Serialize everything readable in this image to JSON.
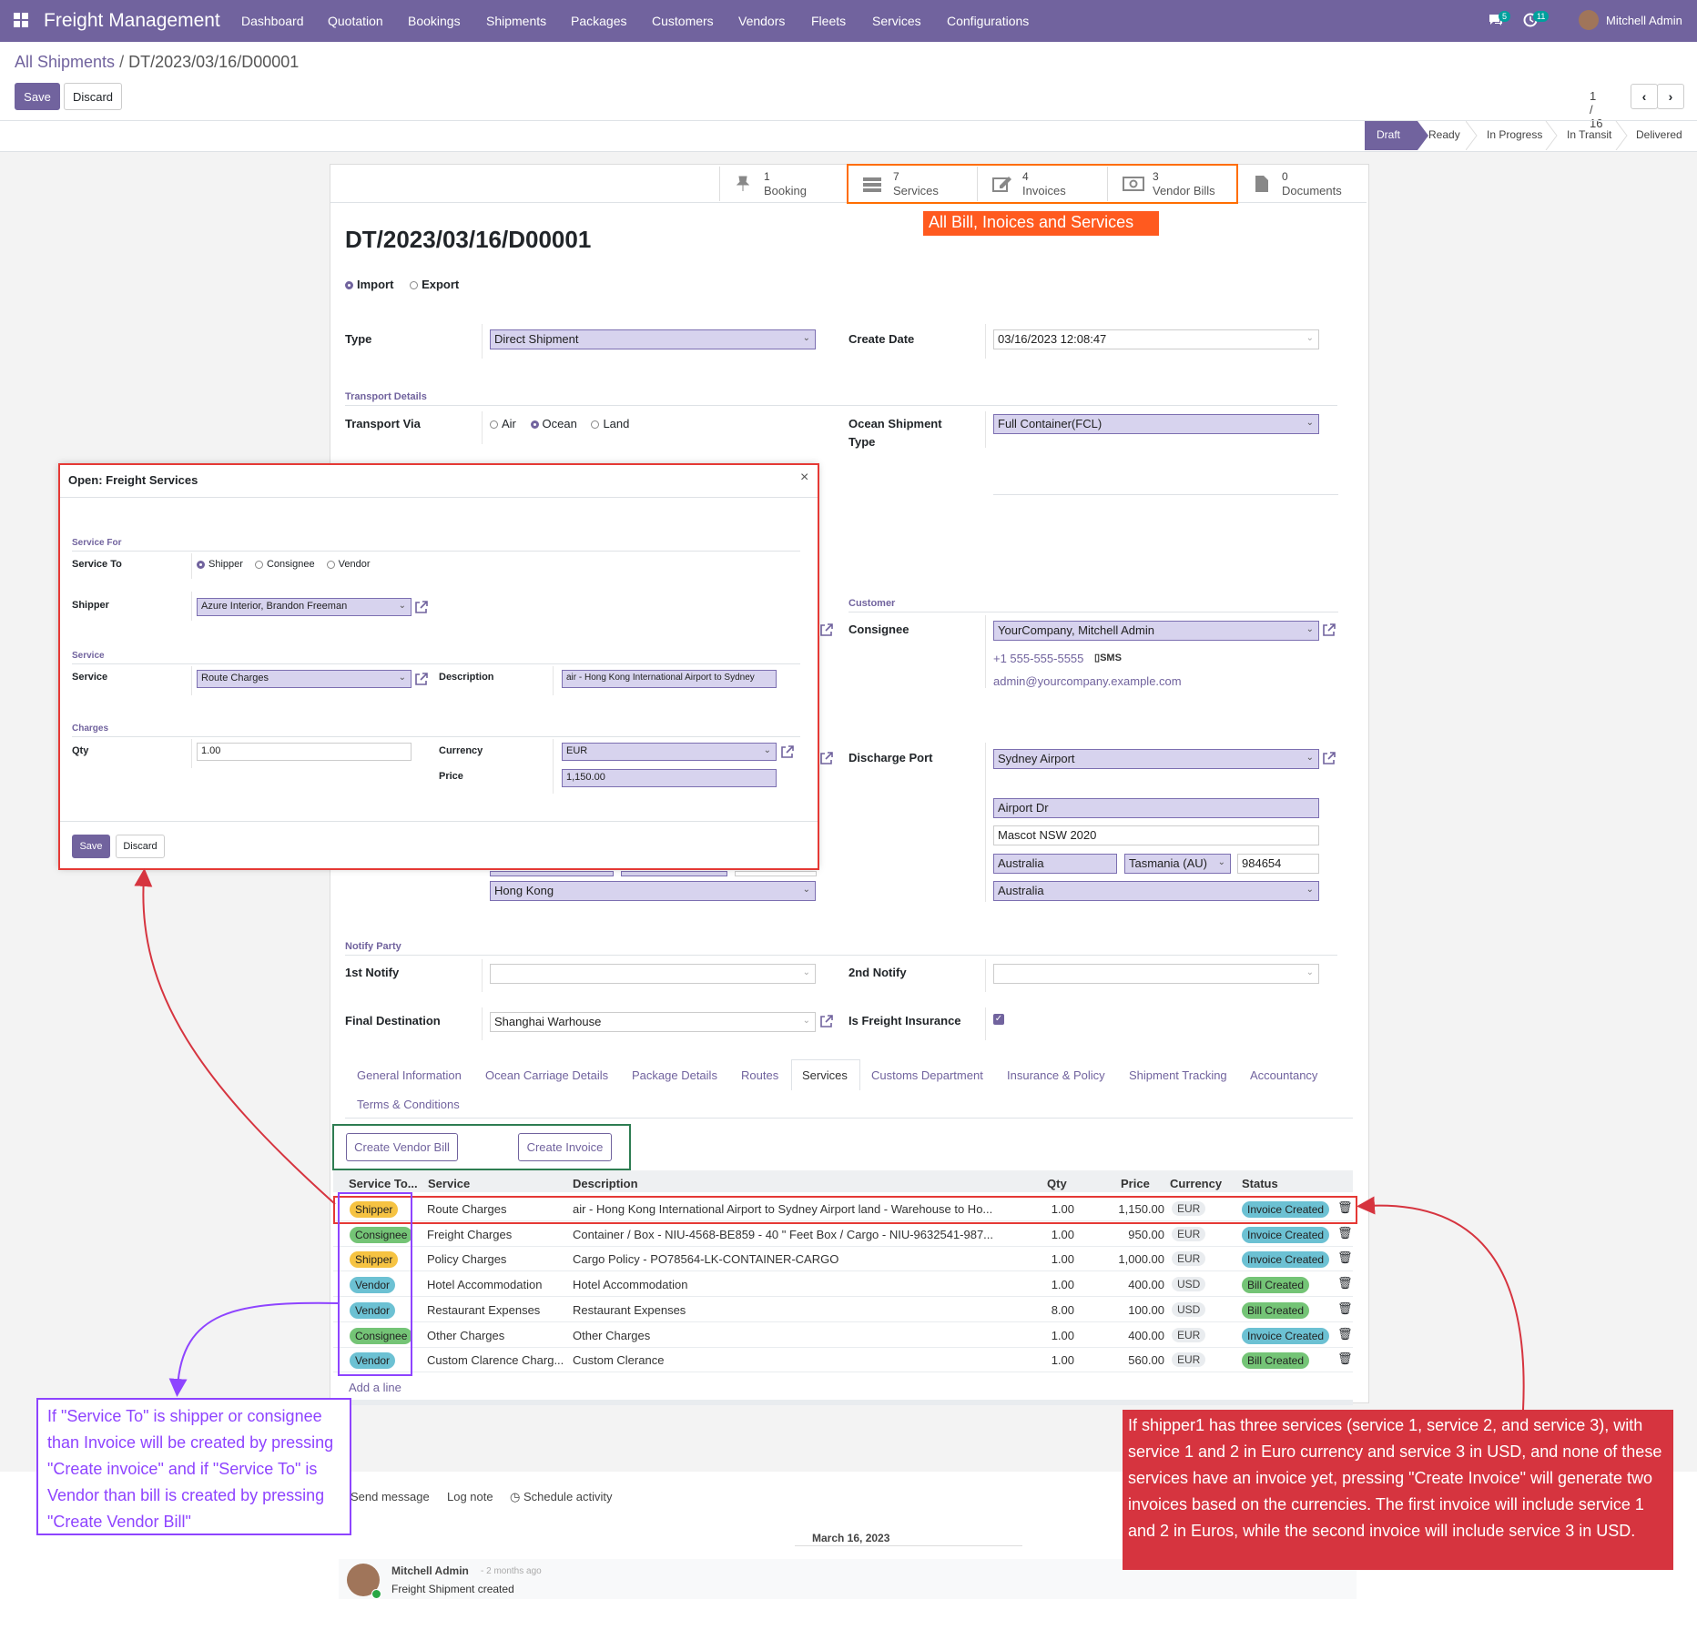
{
  "nav": {
    "brand": "Freight Management",
    "menus": [
      "Dashboard",
      "Quotation",
      "Bookings",
      "Shipments",
      "Packages",
      "Customers",
      "Vendors",
      "Fleets",
      "Services",
      "Configurations"
    ],
    "msg_count": "5",
    "activity_count": "11",
    "user": "Mitchell Admin"
  },
  "breadcrumb": {
    "parent": "All Shipments",
    "sep": "/",
    "current": "DT/2023/03/16/D00001"
  },
  "actions": {
    "save": "Save",
    "discard": "Discard"
  },
  "pager": {
    "text": "1 / 16"
  },
  "statusbar": [
    "Draft",
    "Ready",
    "In Progress",
    "In Transit",
    "Delivered"
  ],
  "smart_buttons": [
    {
      "count": "1",
      "label": "Booking"
    },
    {
      "count": "7",
      "label": "Services"
    },
    {
      "count": "4",
      "label": "Invoices"
    },
    {
      "count": "3",
      "label": "Vendor Bills"
    },
    {
      "count": "0",
      "label": "Documents"
    }
  ],
  "record": {
    "title": "DT/2023/03/16/D00001",
    "direction": [
      "Import",
      "Export"
    ],
    "type_label": "Type",
    "type_value": "Direct Shipment",
    "create_date_label": "Create Date",
    "create_date": "03/16/2023 12:08:47",
    "transport_details": "Transport Details",
    "transport_via_label": "Transport Via",
    "transport_options": [
      "Air",
      "Ocean",
      "Land"
    ],
    "ocean_type_label_1": "Ocean Shipment",
    "ocean_type_label_2": "Type",
    "ocean_type_value": "Full Container(FCL)",
    "customer_section": "Customer",
    "consignee_label": "Consignee",
    "consignee_value": "YourCompany, Mitchell Admin",
    "consignee_phone": "+1 555-555-5555",
    "sms": "SMS",
    "consignee_email": "admin@yourcompany.example.com",
    "discharge_port_label": "Discharge Port",
    "discharge_port": "Sydney Airport",
    "street": "Airport Dr",
    "city": "Mascot NSW 2020",
    "country_a": "Australia",
    "state": "Tasmania (AU)",
    "zip": "984654",
    "country_b": "Australia",
    "left_country": "Hong Kong",
    "notify_party": "Notify Party",
    "first_notify_label": "1st Notify",
    "second_notify_label": "2nd Notify",
    "final_destination_label": "Final Destination",
    "final_destination": "Shanghai Warhouse",
    "insurance_label": "Is Freight Insurance"
  },
  "tabs": [
    "General Information",
    "Ocean Carriage Details",
    "Package Details",
    "Routes",
    "Services",
    "Customs Department",
    "Insurance & Policy",
    "Shipment Tracking",
    "Accountancy",
    "Terms & Conditions"
  ],
  "service_buttons": {
    "vendor_bill": "Create Vendor Bill",
    "invoice": "Create Invoice"
  },
  "table": {
    "headers": [
      "Service To...",
      "Service",
      "Description",
      "Qty",
      "Price",
      "Currency",
      "Status"
    ],
    "rows": [
      {
        "to": "Shipper",
        "service": "Route Charges",
        "desc": "air - Hong Kong International Airport to Sydney Airport land - Warehouse to Ho...",
        "qty": "1.00",
        "price": "1,150.00",
        "cur": "EUR",
        "status": "Invoice Created"
      },
      {
        "to": "Consignee",
        "service": "Freight Charges",
        "desc": "Container / Box - NIU-4568-BE859 - 40 \" Feet Box / Cargo - NIU-9632541-987...",
        "qty": "1.00",
        "price": "950.00",
        "cur": "EUR",
        "status": "Invoice Created"
      },
      {
        "to": "Shipper",
        "service": "Policy Charges",
        "desc": "Cargo Policy - PO78564-LK-CONTAINER-CARGO",
        "qty": "1.00",
        "price": "1,000.00",
        "cur": "EUR",
        "status": "Invoice Created"
      },
      {
        "to": "Vendor",
        "service": "Hotel Accommodation",
        "desc": "Hotel Accommodation",
        "qty": "1.00",
        "price": "400.00",
        "cur": "USD",
        "status": "Bill Created"
      },
      {
        "to": "Vendor",
        "service": "Restaurant Expenses",
        "desc": "Restaurant Expenses",
        "qty": "8.00",
        "price": "100.00",
        "cur": "USD",
        "status": "Bill Created"
      },
      {
        "to": "Consignee",
        "service": "Other Charges",
        "desc": "Other Charges",
        "qty": "1.00",
        "price": "400.00",
        "cur": "EUR",
        "status": "Invoice Created"
      },
      {
        "to": "Vendor",
        "service": "Custom Clarence Charg...",
        "desc": "Custom Clerance",
        "qty": "1.00",
        "price": "560.00",
        "cur": "EUR",
        "status": "Bill Created"
      }
    ],
    "add_line": "Add a line"
  },
  "chatter": {
    "send": "Send message",
    "log": "Log note",
    "schedule": "Schedule activity",
    "date": "March 16, 2023",
    "author": "Mitchell Admin",
    "ago": "- 2 months ago",
    "message": "Freight Shipment created"
  },
  "dialog": {
    "title": "Open: Freight Services",
    "close": "×",
    "service_for": "Service For",
    "service_to_label": "Service To",
    "service_to_options": [
      "Shipper",
      "Consignee",
      "Vendor"
    ],
    "shipper_label": "Shipper",
    "shipper_value": "Azure Interior, Brandon Freeman",
    "service_section": "Service",
    "service_label": "Service",
    "service_value": "Route Charges",
    "description_label": "Description",
    "description_value": "air - Hong Kong International Airport to Sydney",
    "charges_section": "Charges",
    "qty_label": "Qty",
    "qty_value": "1.00",
    "currency_label": "Currency",
    "currency_value": "EUR",
    "price_label": "Price",
    "price_value": "1,150.00",
    "save": "Save",
    "discard": "Discard"
  },
  "annotations": {
    "orange": "All Bill, Inoices and Services",
    "purple": "If \"Service To\" is shipper or consignee than Invoice will be created by pressing \"Create invoice\" and if \"Service To\" is Vendor than bill is created by pressing \"Create Vendor Bill\"",
    "red": "If shipper1 has three services (service 1, service 2, and service 3), with service 1 and 2 in Euro currency and service 3 in USD, and none of these services have an invoice yet, pressing \"Create Invoice\" will generate two invoices based on the currencies. The first invoice will include service 1 and 2 in Euros, while the second invoice will include service 3 in USD."
  },
  "colors": {
    "brand": "#71639e",
    "annotation_red": "#d6343f",
    "annotation_orange": "#ff5a1f",
    "annotation_purple": "#8e44ff",
    "annotation_green": "#2e7d52"
  }
}
